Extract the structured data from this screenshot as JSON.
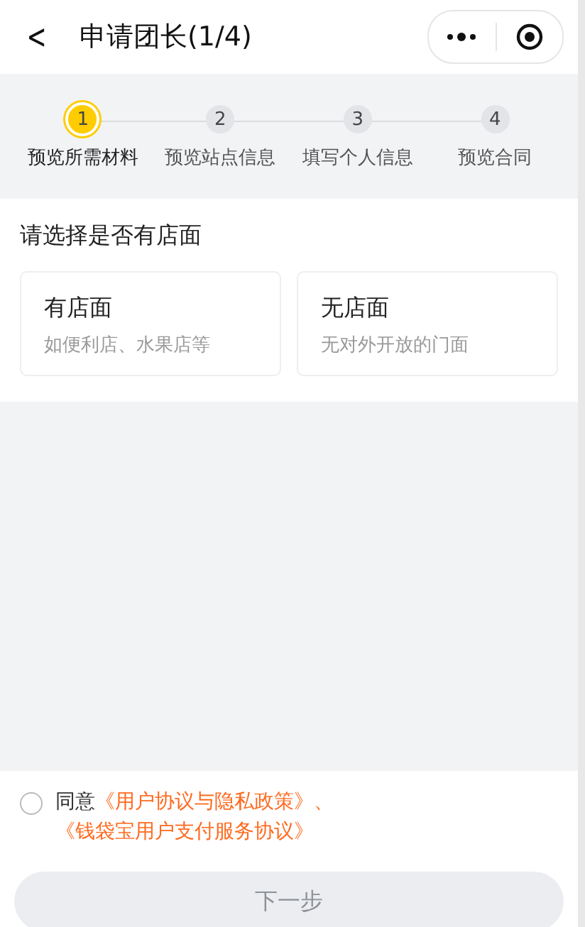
{
  "nav": {
    "back": "<",
    "title": "申请团长(1/4)"
  },
  "steps": [
    {
      "number": "1",
      "label": "预览所需材料",
      "selected": true
    },
    {
      "number": "2",
      "label": "预览站点信息",
      "selected": false
    },
    {
      "number": "3",
      "label": "填写个人信息",
      "selected": false
    },
    {
      "number": "4",
      "label": "预览合同",
      "selected": false
    }
  ],
  "question": "请选择是否有店面",
  "options": [
    {
      "title": "有店面",
      "subtitle": "如便利店、水果店等",
      "selected": false
    },
    {
      "title": "无店面",
      "subtitle": "无对外开放的门面",
      "selected": false
    }
  ],
  "agreement": {
    "checked": false,
    "prefix": "同意",
    "links": [
      "《用户协议与隐私政策》",
      "《钱袋宝用户支付服务协议》"
    ],
    "separator": "、"
  },
  "next_button": {
    "label": "下一步",
    "disabled": true
  }
}
